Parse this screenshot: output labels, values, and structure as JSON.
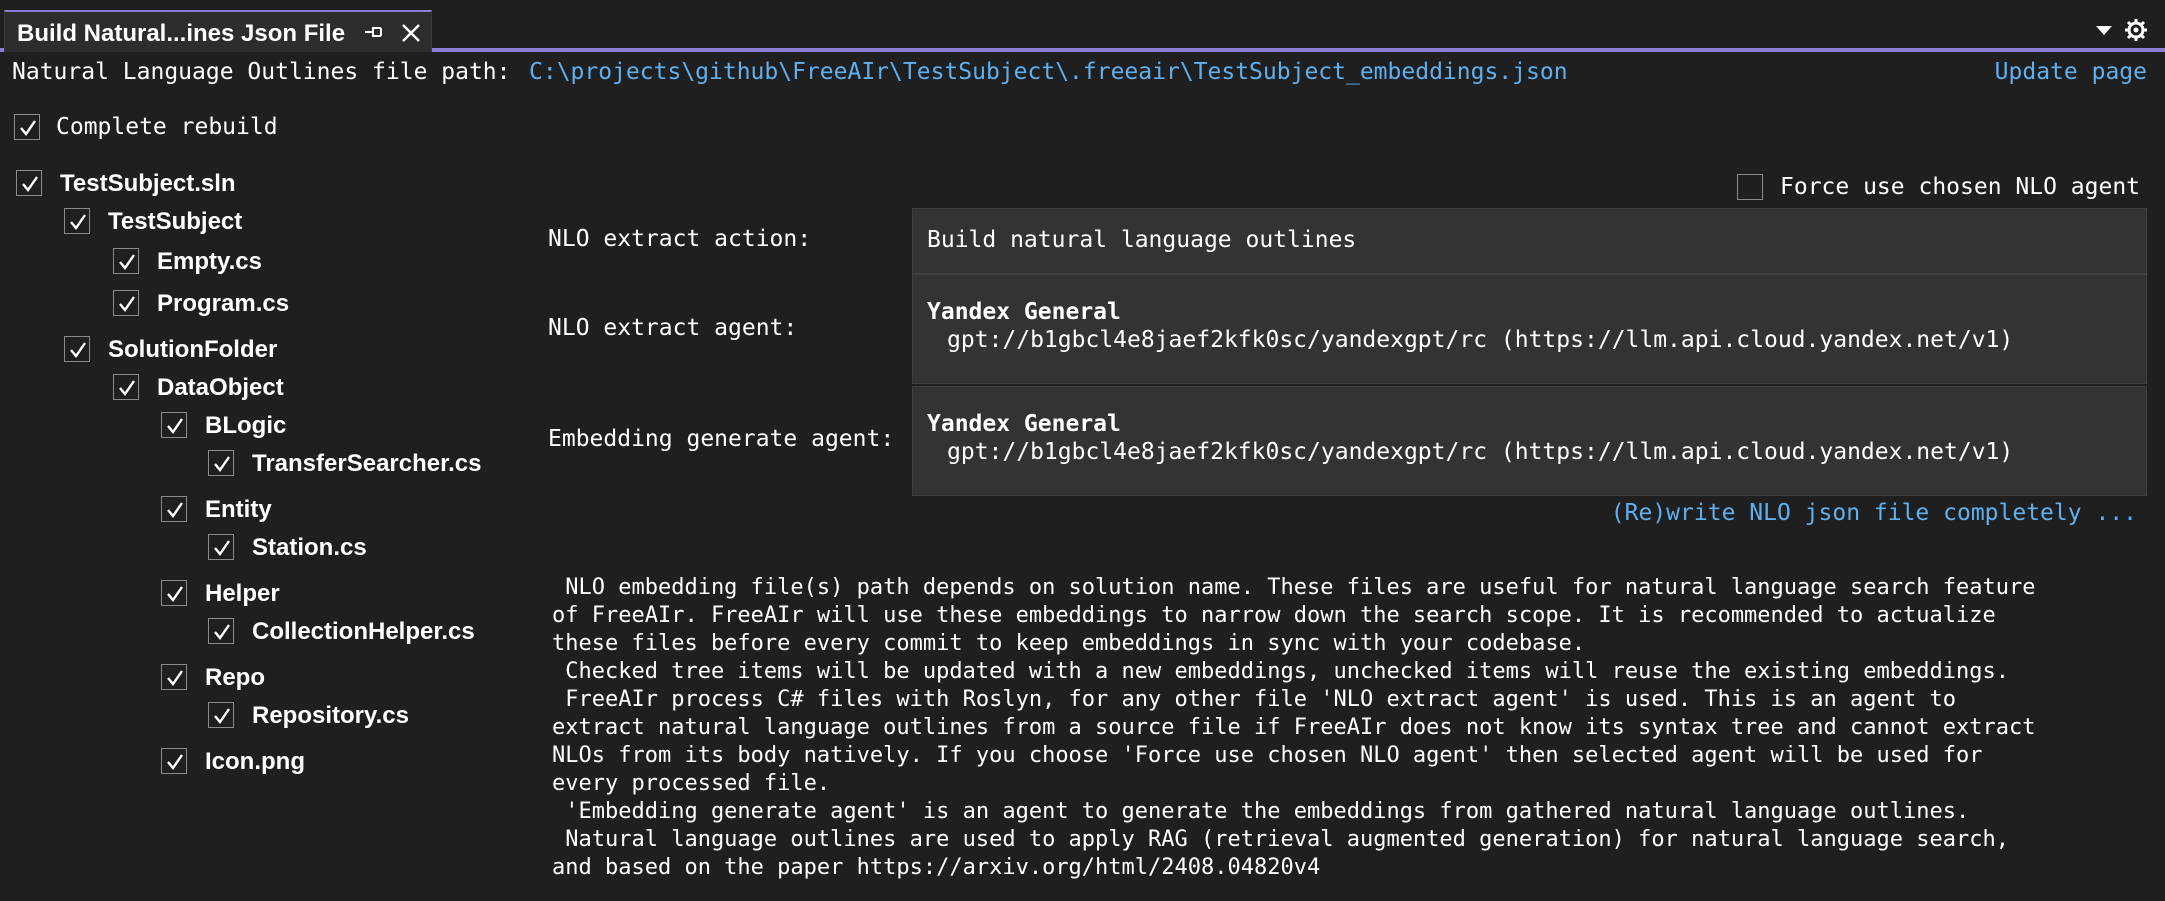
{
  "tab": {
    "title": "Build Natural...ines Json File",
    "pin_icon": "pin-icon",
    "close_icon": "close-icon"
  },
  "toolwindow": {
    "dropdown_icon": "chevron-down-icon",
    "settings_icon": "gear-icon"
  },
  "path": {
    "label": "Natural Language Outlines file path:",
    "value": "C:\\projects\\github\\FreeAIr\\TestSubject\\.freeair\\TestSubject_embeddings.json",
    "update_link": "Update page"
  },
  "complete_rebuild": {
    "label": "Complete rebuild",
    "checked": true
  },
  "tree": [
    {
      "label": "TestSubject.sln",
      "checked": true
    },
    {
      "label": "TestSubject",
      "checked": true
    },
    {
      "label": "Empty.cs",
      "checked": true
    },
    {
      "label": "Program.cs",
      "checked": true
    },
    {
      "label": "SolutionFolder",
      "checked": true
    },
    {
      "label": "DataObject",
      "checked": true
    },
    {
      "label": "BLogic",
      "checked": true
    },
    {
      "label": "TransferSearcher.cs",
      "checked": true
    },
    {
      "label": "Entity",
      "checked": true
    },
    {
      "label": "Station.cs",
      "checked": true
    },
    {
      "label": "Helper",
      "checked": true
    },
    {
      "label": "CollectionHelper.cs",
      "checked": true
    },
    {
      "label": "Repo",
      "checked": true
    },
    {
      "label": "Repository.cs",
      "checked": true
    },
    {
      "label": "Icon.png",
      "checked": true
    }
  ],
  "force_agent": {
    "label": "Force use chosen NLO agent",
    "checked": false
  },
  "extract_action": {
    "label": "NLO extract action:",
    "value": "Build natural language outlines"
  },
  "extract_agent": {
    "label": "NLO extract agent:",
    "name": "Yandex General",
    "model": "gpt://b1gbcl4e8jaef2kfk0sc/yandexgpt/rc (https://llm.api.cloud.yandex.net/v1)"
  },
  "embedding_agent": {
    "label": "Embedding generate agent:",
    "name": "Yandex General",
    "model": "gpt://b1gbcl4e8jaef2kfk0sc/yandexgpt/rc (https://llm.api.cloud.yandex.net/v1)"
  },
  "rewrite_link": "(Re)write NLO json file completely ...",
  "description": " NLO embedding file(s) path depends on solution name. These files are useful for natural language search feature\nof FreeAIr. FreeAIr will use these embeddings to narrow down the search scope. It is recommended to actualize\nthese files before every commit to keep embeddings in sync with your codebase.\n Checked tree items will be updated with a new embeddings, unchecked items will reuse the existing embeddings.\n FreeAIr process C# files with Roslyn, for any other file 'NLO extract agent' is used. This is an agent to\nextract natural language outlines from a source file if FreeAIr does not know its syntax tree and cannot extract\nNLOs from its body natively. If you choose 'Force use chosen NLO agent' then selected agent will be used for\nevery processed file.\n 'Embedding generate agent' is an agent to generate the embeddings from gathered natural language outlines.\n Natural language outlines are used to apply RAG (retrieval augmented generation) for natural language search,\nand based on the paper https://arxiv.org/html/2408.04820v4",
  "colors": {
    "background": "#1f1f1f",
    "accent": "#8c7cd8",
    "link": "#5fb0f0",
    "combo_background": "#333333"
  }
}
